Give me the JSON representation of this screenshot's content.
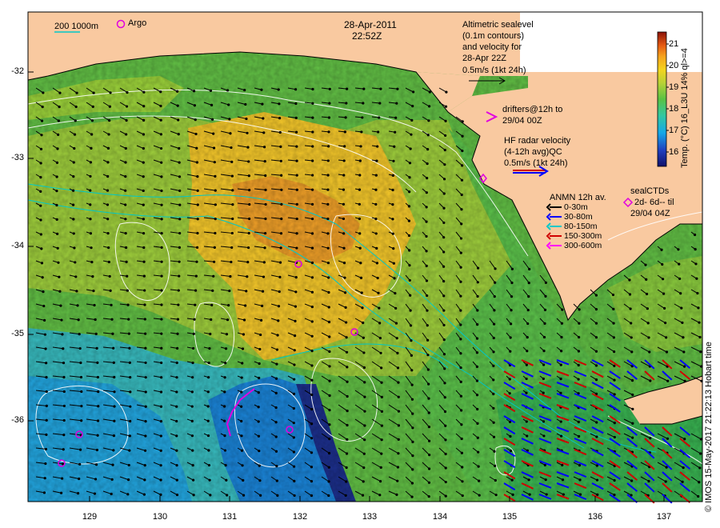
{
  "header": {
    "date": "28-Apr-2011",
    "time": "22:52Z"
  },
  "scale_legend": {
    "label": "200 1000m",
    "argo_label": "Argo"
  },
  "altimetry": {
    "lines": [
      "Altimetric sealevel",
      "(0.1m contours)",
      "and velocity for",
      "28-Apr 22Z",
      "0.5m/s (1kt 24h)"
    ]
  },
  "drifters": {
    "symbol": ">",
    "lines": [
      "drifters@12h to",
      "29/04 00Z"
    ]
  },
  "hf_radar": {
    "lines": [
      "HF radar velocity",
      "(4-12h avg)QC",
      "0.5m/s (1kt 24h)"
    ]
  },
  "anmn": {
    "title": "ANMN 12h av.",
    "items": [
      {
        "label": "0-30m",
        "color": "#000000"
      },
      {
        "label": "30-80m",
        "color": "#0000ff"
      },
      {
        "label": "80-150m",
        "color": "#00c8c8"
      },
      {
        "label": "150-300m",
        "color": "#d00000"
      },
      {
        "label": "300-600m",
        "color": "#ff00ff"
      }
    ]
  },
  "seal_ctds": {
    "title": "sealCTDs",
    "line2": "2d- 6d-- til",
    "line3": "29/04 04Z"
  },
  "colorbar": {
    "title": "Temp. (°C) 16_L3U 14% ql>=4",
    "ticks": [
      "16",
      "17",
      "18",
      "19",
      "20",
      "21"
    ]
  },
  "axes": {
    "y_ticks": [
      "-32",
      "-33",
      "-34",
      "-35",
      "-36"
    ],
    "x_ticks": [
      "129",
      "130",
      "131",
      "132",
      "133",
      "134",
      "135",
      "136",
      "137"
    ]
  },
  "credit": "© IMOS 15-May-2017 21:22:13 Hobart time",
  "colors": {
    "land": "#f9c9a0",
    "argo": "#e000e0",
    "scale_line": "#00c8c8"
  }
}
